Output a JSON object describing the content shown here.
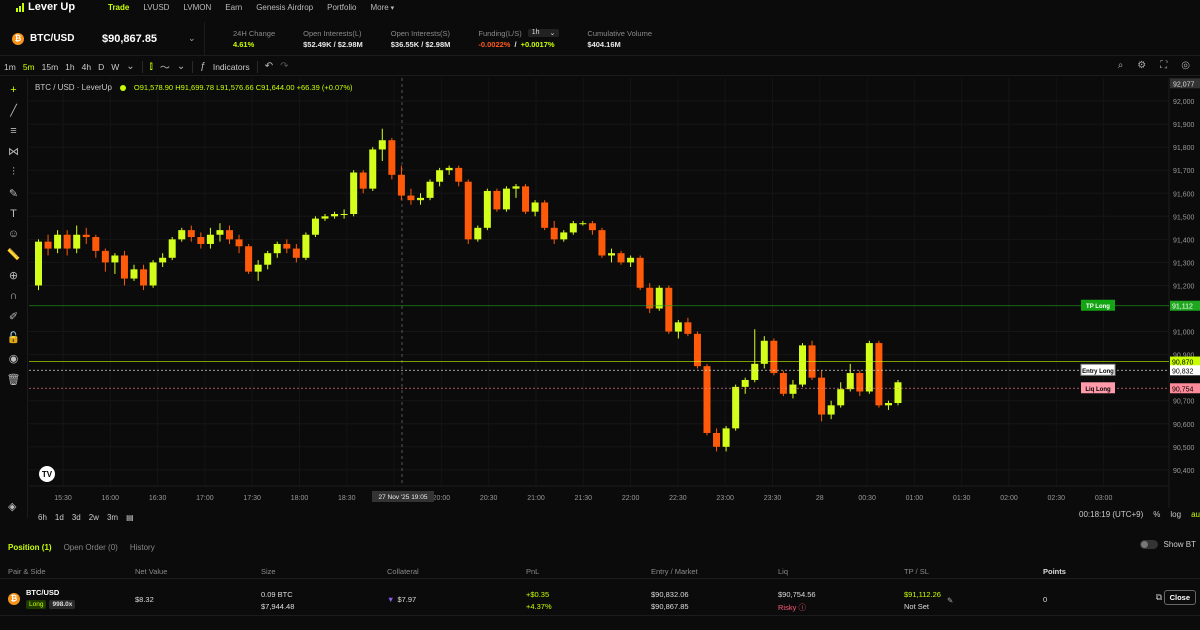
{
  "nav": {
    "logo": "Lever Up",
    "items": [
      "Trade",
      "LVUSD",
      "LVMON",
      "Earn",
      "Genesis Airdrop",
      "Portfolio",
      "More"
    ]
  },
  "ticker": {
    "pair": "BTC/USD",
    "price": "$90,867.85",
    "change_label": "24H Change",
    "change_value": "4.61%",
    "oil_label": "Open Interests(L)",
    "oil_value": "$52.49K / $2.98M",
    "ois_label": "Open Interests(S)",
    "ois_value": "$36.55K / $2.98M",
    "funding_label": "Funding(L/S)",
    "funding_interval": "1h",
    "funding_long": "-0.0022%",
    "funding_sep": "/",
    "funding_short": "+0.0017%",
    "cumvol_label": "Cumulative Volume",
    "cumvol_value": "$404.16M"
  },
  "chart_toolbar": {
    "timeframes": [
      "1m",
      "5m",
      "15m",
      "1h",
      "4h",
      "D",
      "W"
    ],
    "active_timeframe": "5m",
    "indicators_label": "Indicators"
  },
  "chart_data": {
    "type": "candlestick",
    "title": "BTC / USD · LeverUp",
    "ohlc": {
      "o": "O91,578.90",
      "h": "H91,699.78",
      "l": "L91,576.66",
      "c": "C91,644.00",
      "chg": "+66.39 (+0.07%)"
    },
    "ylim": [
      90330,
      92100
    ],
    "y_ticks": [
      "92,000",
      "91,900",
      "91,800",
      "91,700",
      "91,600",
      "91,500",
      "91,400",
      "91,300",
      "91,200",
      "91,000",
      "90,900",
      "90,700",
      "90,600",
      "90,500",
      "90,400"
    ],
    "x_ticks": [
      "15:30",
      "16:00",
      "16:30",
      "17:00",
      "17:30",
      "18:00",
      "18:30",
      "19:30",
      "20:00",
      "20:30",
      "21:00",
      "21:30",
      "22:00",
      "22:30",
      "23:00",
      "23:30",
      "28",
      "00:30",
      "01:00",
      "01:30",
      "02:00",
      "02:30",
      "03:00"
    ],
    "crosshair_label": "27 Nov '25   19:05",
    "top_price_label": "92,077",
    "lines": [
      {
        "name": "TP Long",
        "price": 91112,
        "label": "91,112",
        "color": "#1fa81f"
      },
      {
        "name": "Current",
        "price": 90870,
        "label": "90,870",
        "color": "#c8ff00"
      },
      {
        "name": "Entry Long",
        "price": 90832,
        "label": "90,832",
        "color": "#ffffff"
      },
      {
        "name": "Liq Long",
        "price": 90754,
        "label": "90,754",
        "color": "#ff8a9a"
      }
    ],
    "candles": [
      [
        91200,
        91400,
        91180,
        91390
      ],
      [
        91390,
        91420,
        91330,
        91360
      ],
      [
        91360,
        91440,
        91340,
        91420
      ],
      [
        91420,
        91440,
        91330,
        91360
      ],
      [
        91360,
        91460,
        91340,
        91420
      ],
      [
        91420,
        91450,
        91380,
        91410
      ],
      [
        91410,
        91420,
        91320,
        91350
      ],
      [
        91350,
        91360,
        91260,
        91300
      ],
      [
        91300,
        91340,
        91250,
        91330
      ],
      [
        91330,
        91350,
        91200,
        91230
      ],
      [
        91230,
        91290,
        91220,
        91270
      ],
      [
        91270,
        91290,
        91180,
        91200
      ],
      [
        91200,
        91310,
        91190,
        91300
      ],
      [
        91300,
        91340,
        91280,
        91320
      ],
      [
        91320,
        91410,
        91310,
        91400
      ],
      [
        91400,
        91450,
        91390,
        91440
      ],
      [
        91440,
        91460,
        91390,
        91410
      ],
      [
        91410,
        91430,
        91360,
        91380
      ],
      [
        91380,
        91450,
        91360,
        91420
      ],
      [
        91420,
        91470,
        91390,
        91440
      ],
      [
        91440,
        91460,
        91380,
        91400
      ],
      [
        91400,
        91420,
        91340,
        91370
      ],
      [
        91370,
        91380,
        91250,
        91260
      ],
      [
        91260,
        91310,
        91220,
        91290
      ],
      [
        91290,
        91350,
        91270,
        91340
      ],
      [
        91340,
        91390,
        91320,
        91380
      ],
      [
        91380,
        91400,
        91340,
        91360
      ],
      [
        91360,
        91380,
        91300,
        91320
      ],
      [
        91320,
        91430,
        91310,
        91420
      ],
      [
        91420,
        91500,
        91410,
        91490
      ],
      [
        91490,
        91510,
        91480,
        91500
      ],
      [
        91500,
        91520,
        91490,
        91510
      ],
      [
        91510,
        91530,
        91490,
        91510
      ],
      [
        91510,
        91700,
        91500,
        91690
      ],
      [
        91690,
        91700,
        91600,
        91620
      ],
      [
        91620,
        91800,
        91610,
        91790
      ],
      [
        91790,
        91880,
        91740,
        91830
      ],
      [
        91830,
        91840,
        91660,
        91680
      ],
      [
        91680,
        91720,
        91570,
        91590
      ],
      [
        91590,
        91620,
        91550,
        91570
      ],
      [
        91570,
        91600,
        91550,
        91580
      ],
      [
        91580,
        91660,
        91570,
        91650
      ],
      [
        91650,
        91710,
        91630,
        91700
      ],
      [
        91700,
        91720,
        91680,
        91710
      ],
      [
        91710,
        91720,
        91630,
        91650
      ],
      [
        91650,
        91660,
        91380,
        91400
      ],
      [
        91400,
        91460,
        91390,
        91450
      ],
      [
        91450,
        91620,
        91440,
        91610
      ],
      [
        91610,
        91620,
        91520,
        91530
      ],
      [
        91530,
        91630,
        91520,
        91620
      ],
      [
        91620,
        91640,
        91580,
        91630
      ],
      [
        91630,
        91640,
        91510,
        91520
      ],
      [
        91520,
        91570,
        91500,
        91560
      ],
      [
        91560,
        91570,
        91440,
        91450
      ],
      [
        91450,
        91480,
        91380,
        91400
      ],
      [
        91400,
        91440,
        91390,
        91430
      ],
      [
        91430,
        91480,
        91420,
        91470
      ],
      [
        91470,
        91480,
        91460,
        91470
      ],
      [
        91470,
        91480,
        91420,
        91440
      ],
      [
        91440,
        91450,
        91320,
        91330
      ],
      [
        91330,
        91360,
        91300,
        91340
      ],
      [
        91340,
        91350,
        91290,
        91300
      ],
      [
        91300,
        91330,
        91280,
        91320
      ],
      [
        91320,
        91330,
        91180,
        91190
      ],
      [
        91190,
        91210,
        91080,
        91100
      ],
      [
        91100,
        91200,
        91090,
        91190
      ],
      [
        91190,
        91200,
        90990,
        91000
      ],
      [
        91000,
        91050,
        90970,
        91040
      ],
      [
        91040,
        91060,
        90980,
        90990
      ],
      [
        90990,
        91000,
        90840,
        90850
      ],
      [
        90850,
        90860,
        90550,
        90560
      ],
      [
        90560,
        90580,
        90480,
        90500
      ],
      [
        90500,
        90590,
        90480,
        90580
      ],
      [
        90580,
        90770,
        90570,
        90760
      ],
      [
        90760,
        90800,
        90730,
        90790
      ],
      [
        90790,
        91010,
        90780,
        90860
      ],
      [
        90860,
        90980,
        90840,
        90960
      ],
      [
        90960,
        90970,
        90810,
        90820
      ],
      [
        90820,
        90830,
        90720,
        90730
      ],
      [
        90730,
        90790,
        90710,
        90770
      ],
      [
        90770,
        90950,
        90760,
        90940
      ],
      [
        90940,
        90960,
        90790,
        90800
      ],
      [
        90800,
        90830,
        90610,
        90640
      ],
      [
        90640,
        90700,
        90620,
        90680
      ],
      [
        90680,
        90780,
        90670,
        90750
      ],
      [
        90750,
        90860,
        90740,
        90820
      ],
      [
        90820,
        90830,
        90720,
        90740
      ],
      [
        90740,
        90960,
        90730,
        90950
      ],
      [
        90950,
        90960,
        90670,
        90680
      ],
      [
        90680,
        90700,
        90660,
        90690
      ],
      [
        90690,
        90790,
        90680,
        90780
      ]
    ]
  },
  "left_tools": [
    "crosshair-icon",
    "trendline-icon",
    "hlines-icon",
    "pattern-icon",
    "fib-icon",
    "brush-icon",
    "text-icon",
    "emoji-icon",
    "ruler-icon",
    "zoom-in-icon",
    "magnet-icon",
    "pencil-lock-icon",
    "lock-icon",
    "eye-icon",
    "trash-icon"
  ],
  "bottom_toolbar": {
    "ranges": [
      "6h",
      "1d",
      "3d",
      "2w",
      "3m"
    ],
    "clock": "00:18:19 (UTC+9)",
    "pct": "%",
    "log": "log",
    "auto": "au"
  },
  "positions": {
    "tabs": [
      "Position (1)",
      "Open Order (0)",
      "History"
    ],
    "show_label": "Show BT",
    "headers": [
      "Pair & Side",
      "Net Value",
      "Size",
      "Collateral",
      "PnL",
      "Entry / Market",
      "Liq",
      "TP / SL",
      "Points"
    ],
    "row": {
      "pair": "BTC/USD",
      "side": "Long",
      "leverage": "998.0x",
      "net_value": "$8.32",
      "size_btc": "0.09 BTC",
      "size_usd": "$7,944.48",
      "collateral": "$7.97",
      "pnl_usd": "+$0.35",
      "pnl_pct": "+4.37%",
      "entry": "$90,832.06",
      "market": "$90,867.85",
      "liq": "$90,754.56",
      "liq_status": "Risky",
      "tp": "$91,112.26",
      "sl": "Not Set",
      "points": "0",
      "close_label": "Close"
    }
  }
}
